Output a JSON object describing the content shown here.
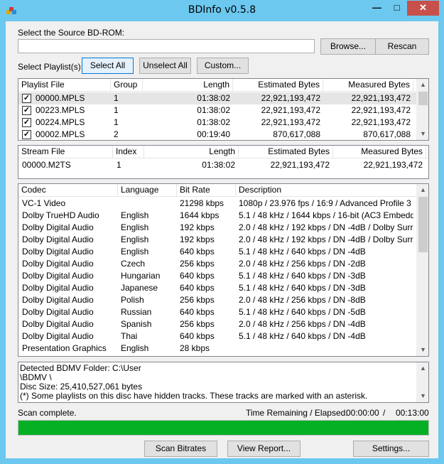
{
  "window": {
    "title": "BDInfo v0.5.8",
    "controls": {
      "minimize": "—",
      "maximize": "□",
      "close": "✕"
    }
  },
  "source": {
    "label": "Select the Source BD-ROM:",
    "value": "",
    "browse_label": "Browse...",
    "rescan_label": "Rescan"
  },
  "playlist_select": {
    "label": "Select Playlist(s):",
    "select_all": "Select All",
    "unselect_all": "Unselect All",
    "custom": "Custom..."
  },
  "playlists": {
    "headers": [
      "Playlist File",
      "Group",
      "Length",
      "Estimated Bytes",
      "Measured Bytes"
    ],
    "rows": [
      {
        "file": "00000.MPLS",
        "group": "1",
        "length": "01:38:02",
        "estimated": "22,921,193,472",
        "measured": "22,921,193,472",
        "checked": true
      },
      {
        "file": "00223.MPLS",
        "group": "1",
        "length": "01:38:02",
        "estimated": "22,921,193,472",
        "measured": "22,921,193,472",
        "checked": true
      },
      {
        "file": "00224.MPLS",
        "group": "1",
        "length": "01:38:02",
        "estimated": "22,921,193,472",
        "measured": "22,921,193,472",
        "checked": true
      },
      {
        "file": "00002.MPLS",
        "group": "2",
        "length": "00:19:40",
        "estimated": "870,617,088",
        "measured": "870,617,088",
        "checked": true
      }
    ]
  },
  "streams": {
    "headers": [
      "Stream File",
      "Index",
      "Length",
      "Estimated Bytes",
      "Measured Bytes"
    ],
    "rows": [
      {
        "file": "00000.M2TS",
        "index": "1",
        "length": "01:38:02",
        "estimated": "22,921,193,472",
        "measured": "22,921,193,472"
      }
    ]
  },
  "codecs": {
    "headers": [
      "Codec",
      "Language",
      "Bit Rate",
      "Description"
    ],
    "rows": [
      {
        "codec": "VC-1 Video",
        "language": "",
        "bitrate": "21298 kbps",
        "description": "1080p / 23.976 fps / 16:9 / Advanced Profile 3"
      },
      {
        "codec": "Dolby TrueHD Audio",
        "language": "English",
        "bitrate": "1644 kbps",
        "description": "5.1 / 48 kHz / 1644 kbps / 16-bit (AC3 Embedd..."
      },
      {
        "codec": "Dolby Digital Audio",
        "language": "English",
        "bitrate": "192 kbps",
        "description": "2.0 / 48 kHz / 192 kbps / DN -4dB / Dolby Surr..."
      },
      {
        "codec": "Dolby Digital Audio",
        "language": "English",
        "bitrate": "192 kbps",
        "description": "2.0 / 48 kHz / 192 kbps / DN -4dB / Dolby Surr..."
      },
      {
        "codec": "Dolby Digital Audio",
        "language": "English",
        "bitrate": "640 kbps",
        "description": "5.1 / 48 kHz / 640 kbps / DN -4dB"
      },
      {
        "codec": "Dolby Digital Audio",
        "language": "Czech",
        "bitrate": "256 kbps",
        "description": "2.0 / 48 kHz / 256 kbps / DN -2dB"
      },
      {
        "codec": "Dolby Digital Audio",
        "language": "Hungarian",
        "bitrate": "640 kbps",
        "description": "5.1 / 48 kHz / 640 kbps / DN -3dB"
      },
      {
        "codec": "Dolby Digital Audio",
        "language": "Japanese",
        "bitrate": "640 kbps",
        "description": "5.1 / 48 kHz / 640 kbps / DN -3dB"
      },
      {
        "codec": "Dolby Digital Audio",
        "language": "Polish",
        "bitrate": "256 kbps",
        "description": "2.0 / 48 kHz / 256 kbps / DN -8dB"
      },
      {
        "codec": "Dolby Digital Audio",
        "language": "Russian",
        "bitrate": "640 kbps",
        "description": "5.1 / 48 kHz / 640 kbps / DN -5dB"
      },
      {
        "codec": "Dolby Digital Audio",
        "language": "Spanish",
        "bitrate": "256 kbps",
        "description": "2.0 / 48 kHz / 256 kbps / DN -4dB"
      },
      {
        "codec": "Dolby Digital Audio",
        "language": "Thai",
        "bitrate": "640 kbps",
        "description": "5.1 / 48 kHz / 640 kbps / DN -4dB"
      },
      {
        "codec": "Presentation Graphics",
        "language": "English",
        "bitrate": "28 kbps",
        "description": ""
      }
    ]
  },
  "log": {
    "lines": [
      "Detected BDMV Folder: C:\\User",
      "\\BDMV \\",
      "Disc Size: 25,410,527,061 bytes",
      "(*) Some playlists on this disc have hidden tracks. These tracks are marked with an asterisk."
    ]
  },
  "status": {
    "text": "Scan complete.",
    "time_label": "Time Remaining / Elapsed:",
    "remaining": "00:00:00",
    "separator": "/",
    "elapsed": "00:13:00",
    "progress": 1.0,
    "progress_color": "#06b025"
  },
  "actions": {
    "scan_bitrates": "Scan Bitrates",
    "view_report": "View Report...",
    "settings": "Settings..."
  }
}
